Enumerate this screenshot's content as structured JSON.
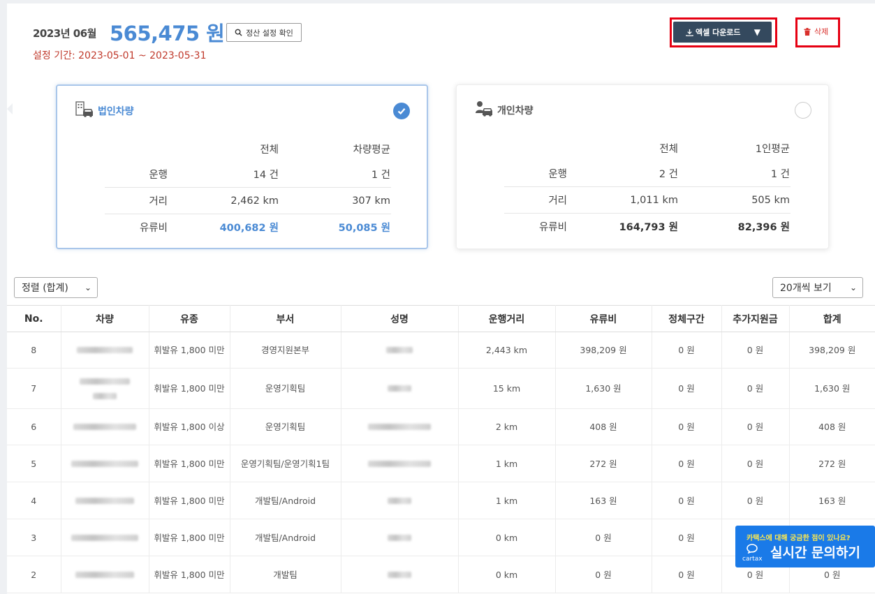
{
  "header": {
    "date": "2023년 06월",
    "amount": "565,475 원",
    "period": "설정 기간: 2023-05-01 ~ 2023-05-31",
    "check_btn": "정산 설정 확인",
    "excel_btn": "엑셀 다운로드",
    "delete_btn": "삭제"
  },
  "corp": {
    "title": "법인차량",
    "col_total": "전체",
    "col_avg": "차량평균",
    "rows": [
      {
        "label": "운행",
        "total": "14 건",
        "avg": "1 건"
      },
      {
        "label": "거리",
        "total": "2,462 km",
        "avg": "307 km"
      },
      {
        "label": "유류비",
        "total": "400,682 원",
        "avg": "50,085 원"
      }
    ]
  },
  "personal": {
    "title": "개인차량",
    "col_total": "전체",
    "col_avg": "1인평균",
    "rows": [
      {
        "label": "운행",
        "total": "2 건",
        "avg": "1 건"
      },
      {
        "label": "거리",
        "total": "1,011 km",
        "avg": "505 km"
      },
      {
        "label": "유류비",
        "total": "164,793 원",
        "avg": "82,396 원"
      }
    ]
  },
  "controls": {
    "sort": "정렬 (합계)",
    "page_size": "20개씩 보기"
  },
  "table": {
    "headers": [
      "No.",
      "차량",
      "유종",
      "부서",
      "성명",
      "운행거리",
      "유류비",
      "정체구간",
      "추가지원금",
      "합계"
    ],
    "rows": [
      {
        "no": "8",
        "fuel": "휘발유 1,800 미만",
        "dept": "경영지원본부",
        "distance": "2,443 km",
        "fuelcost": "398,209 원",
        "jam": "0 원",
        "extra": "0 원",
        "total": "398,209 원"
      },
      {
        "no": "7",
        "fuel": "휘발유 1,800 미만",
        "dept": "운영기획팀",
        "distance": "15 km",
        "fuelcost": "1,630 원",
        "jam": "0 원",
        "extra": "0 원",
        "total": "1,630 원"
      },
      {
        "no": "6",
        "fuel": "휘발유 1,800 이상",
        "dept": "운영기획팀",
        "distance": "2 km",
        "fuelcost": "408 원",
        "jam": "0 원",
        "extra": "0 원",
        "total": "408 원"
      },
      {
        "no": "5",
        "fuel": "휘발유 1,800 미만",
        "dept": "운영기획팀/운영기획1팀",
        "distance": "1 km",
        "fuelcost": "272 원",
        "jam": "0 원",
        "extra": "0 원",
        "total": "272 원"
      },
      {
        "no": "4",
        "fuel": "휘발유 1,800 미만",
        "dept": "개발팀/Android",
        "distance": "1 km",
        "fuelcost": "163 원",
        "jam": "0 원",
        "extra": "0 원",
        "total": "163 원"
      },
      {
        "no": "3",
        "fuel": "휘발유 1,800 미만",
        "dept": "개발팀/Android",
        "distance": "0 km",
        "fuelcost": "0 원",
        "jam": "0 원",
        "extra": "",
        "total": ""
      },
      {
        "no": "2",
        "fuel": "휘발유 1,800 미만",
        "dept": "개발팀",
        "distance": "0 km",
        "fuelcost": "0 원",
        "jam": "0 원",
        "extra": "0 원",
        "total": "0 원"
      }
    ]
  },
  "chat": {
    "question": "카택스에 대해 궁금한 점이 있나요?",
    "main": "실시간 문의하기",
    "logo": "cartax"
  },
  "colors": {
    "accent": "#4a8ad4",
    "dark_button": "#34495e",
    "highlight": "#e60012",
    "chat": "#1a7ae8"
  }
}
